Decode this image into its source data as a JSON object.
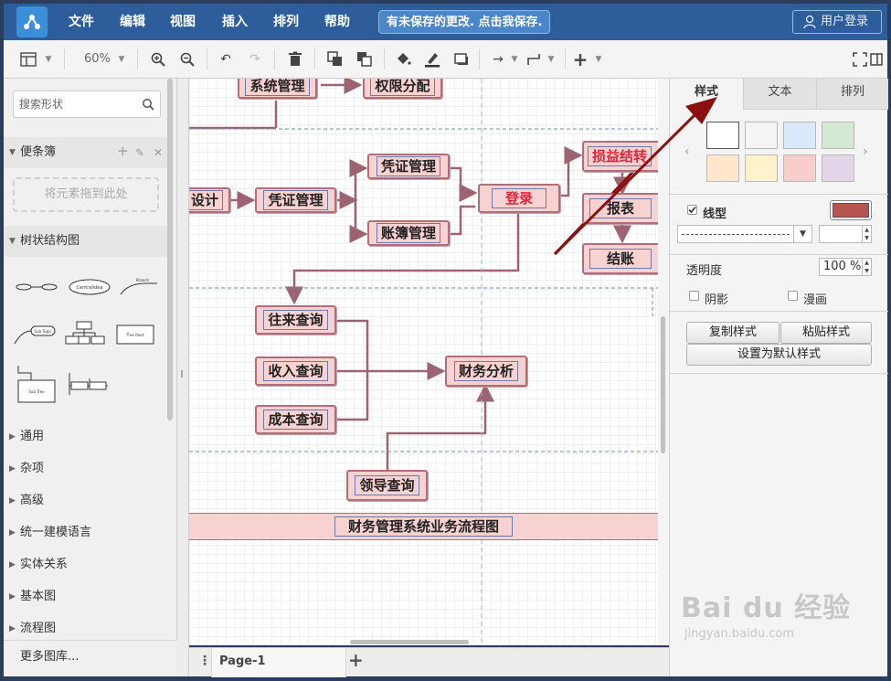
{
  "menu": {
    "items": [
      "文件",
      "编辑",
      "视图",
      "插入",
      "排列",
      "帮助"
    ],
    "unsaved_notice": "有未保存的更改. 点击我保存.",
    "login_label": "用户登录"
  },
  "toolbar": {
    "zoom_level": "60%"
  },
  "left_panel": {
    "search_placeholder": "搜索形状",
    "notes_section": "便条簿",
    "dropzone_hint": "将元素拖到此处",
    "tree_section": "树状结构图",
    "shape_labels": [
      "Centralidea",
      "Branch",
      "Sub Topic",
      "Tree Root",
      "Sub Tree"
    ],
    "sections": [
      "通用",
      "杂项",
      "高级",
      "统一建模语言",
      "实体关系",
      "基本图",
      "流程图"
    ],
    "more_libraries": "更多图库..."
  },
  "diagram": {
    "nodes": {
      "system_mgmt": "系统管理",
      "permission": "权限分配",
      "design": "设计",
      "voucher_mgmt_1": "凭证管理",
      "voucher_mgmt_2": "凭证管理",
      "ledger_mgmt": "账簿管理",
      "login": "登录",
      "profit_transfer": "损益结转",
      "report": "报表",
      "closing": "结账",
      "transaction_query": "往来查询",
      "income_query": "收入查询",
      "cost_query": "成本查询",
      "financial_analysis": "财务分析",
      "leader_query": "领导查询"
    },
    "banner_title": "财务管理系统业务流程图"
  },
  "pages": {
    "current": "Page-1"
  },
  "right_panel": {
    "tabs": [
      "样式",
      "文本",
      "排列"
    ],
    "swatches": [
      "#ffffff",
      "#f5f5f5",
      "#dae8fc",
      "#d5e8d4",
      "#ffe6cc",
      "#fff2cc",
      "#f8cecc",
      "#e1d5e7"
    ],
    "line_label": "线型",
    "line_color": "#b85450",
    "opacity_label": "透明度",
    "opacity_value": "100 %",
    "shadow_label": "阴影",
    "comic_label": "漫画",
    "copy_style": "复制样式",
    "paste_style": "粘贴样式",
    "set_default_style": "设置为默认样式"
  },
  "watermark": {
    "brand": "Bai du 经验",
    "url": "jingyan.baidu.com"
  },
  "colors": {
    "title_bar": "#2d5d9b",
    "node_fill": "#f8d1d1",
    "node_border": "#b06d7a",
    "annotation_arrow": "#8b1010"
  }
}
